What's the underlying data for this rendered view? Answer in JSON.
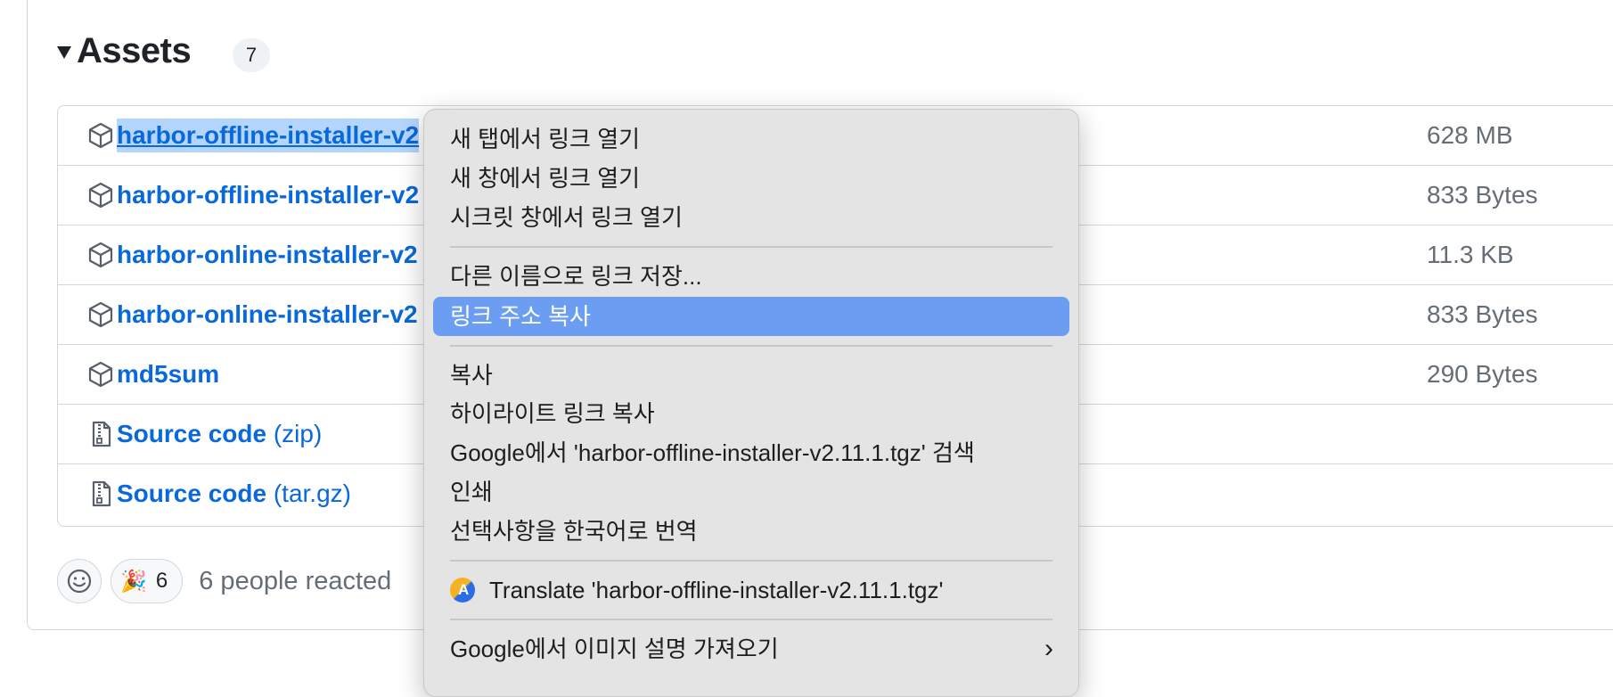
{
  "assets": {
    "title": "Assets",
    "count": "7",
    "rows": [
      {
        "name": "harbor-offline-installer-v2",
        "ext": "",
        "size": "628 MB",
        "icon": "package-icon"
      },
      {
        "name": "harbor-offline-installer-v2",
        "ext": "",
        "size": "833 Bytes",
        "icon": "package-icon"
      },
      {
        "name": "harbor-online-installer-v2",
        "ext": "",
        "size": "11.3 KB",
        "icon": "package-icon"
      },
      {
        "name": "harbor-online-installer-v2",
        "ext": "",
        "size": "833 Bytes",
        "icon": "package-icon"
      },
      {
        "name": "md5sum",
        "ext": "",
        "size": "290 Bytes",
        "icon": "package-icon"
      },
      {
        "name": "Source code",
        "ext": "(zip)",
        "size": "",
        "icon": "file-zip-icon"
      },
      {
        "name": "Source code",
        "ext": "(tar.gz)",
        "size": "",
        "icon": "file-zip-icon"
      }
    ]
  },
  "reactions": {
    "tada_emoji": "🎉",
    "tada_count": "6",
    "summary": "6 people reacted"
  },
  "context_menu": {
    "items": {
      "open_new_tab": "새 탭에서 링크 열기",
      "open_new_window": "새 창에서 링크 열기",
      "open_incognito": "시크릿 창에서 링크 열기",
      "save_link_as": "다른 이름으로 링크 저장...",
      "copy_link_address": "링크 주소 복사",
      "copy": "복사",
      "copy_highlight_link": "하이라이트 링크 복사",
      "google_search": "Google에서 'harbor-offline-installer-v2.11.1.tgz' 검색",
      "print": "인쇄",
      "translate_to_korean": "선택사항을 한국어로 번역",
      "translate_extension": "Translate 'harbor-offline-installer-v2.11.1.tgz'",
      "google_image_description": "Google에서 이미지 설명 가져오기"
    },
    "highlight_color": "#6b9df2"
  },
  "colors": {
    "link": "#0969da",
    "muted_text": "#656d76",
    "border": "#d0d7de",
    "selection": "#b4d5fe"
  }
}
